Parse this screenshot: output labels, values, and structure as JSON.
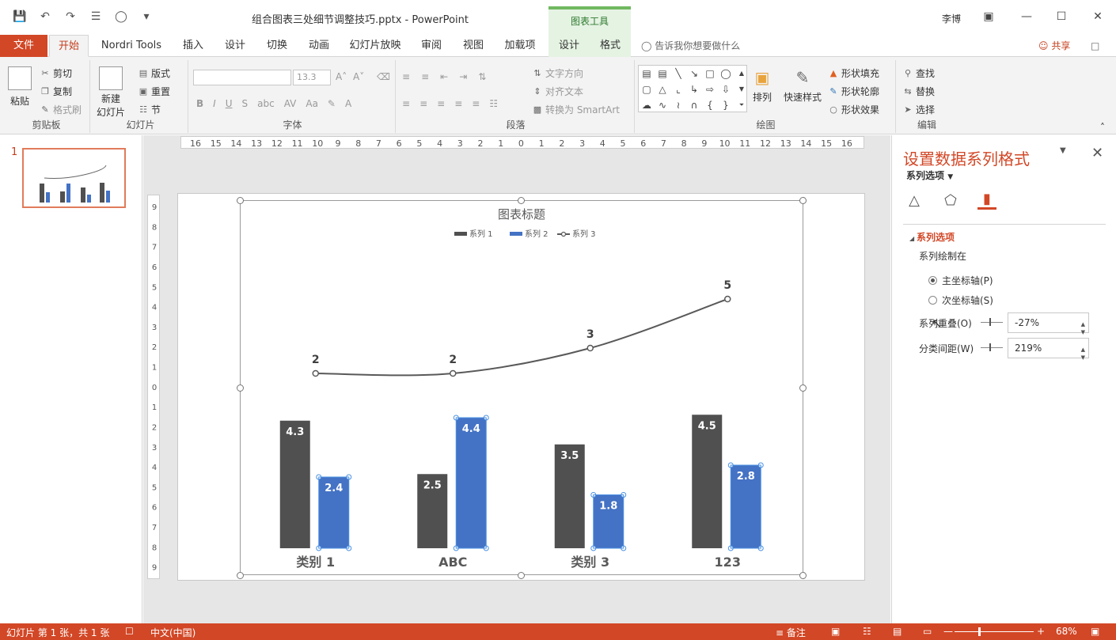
{
  "window": {
    "title": "组合图表三处细节调整技巧.pptx - PowerPoint",
    "context_tab_group": "图表工具",
    "user": "李博"
  },
  "tabs": {
    "file": "文件",
    "items": [
      "开始",
      "Nordri Tools",
      "插入",
      "设计",
      "切换",
      "动画",
      "幻灯片放映",
      "审阅",
      "视图",
      "加载项",
      "设计",
      "格式"
    ],
    "active_index": 0,
    "tell_me": "告诉我你想要做什么",
    "share": "共享"
  },
  "ribbon": {
    "clipboard": {
      "label": "剪贴板",
      "paste": "粘贴",
      "cut": "剪切",
      "copy": "复制",
      "format_painter": "格式刷"
    },
    "slides": {
      "label": "幻灯片",
      "new_slide_1": "新建",
      "new_slide_2": "幻灯片",
      "layout": "版式",
      "reset": "重置",
      "section": "节"
    },
    "font": {
      "label": "字体",
      "font_name": "",
      "font_size": "13.3"
    },
    "paragraph": {
      "label": "段落",
      "text_direction": "文字方向",
      "align_text": "对齐文本",
      "convert_smartart": "转换为 SmartArt"
    },
    "drawing": {
      "label": "绘图",
      "arrange": "排列",
      "quick_styles": "快速样式",
      "shape_fill": "形状填充",
      "shape_outline": "形状轮廓",
      "shape_effects": "形状效果"
    },
    "editing": {
      "label": "编辑",
      "find": "查找",
      "replace": "替换",
      "select": "选择"
    }
  },
  "thumbnails": {
    "number": "1"
  },
  "ruler": {
    "h_ticks": [
      "16",
      "15",
      "14",
      "13",
      "12",
      "11",
      "10",
      "9",
      "8",
      "7",
      "6",
      "5",
      "4",
      "3",
      "2",
      "1",
      "0",
      "1",
      "2",
      "3",
      "4",
      "5",
      "6",
      "7",
      "8",
      "9",
      "10",
      "11",
      "12",
      "13",
      "14",
      "15",
      "16"
    ],
    "v_ticks": [
      "9",
      "8",
      "7",
      "6",
      "5",
      "4",
      "3",
      "2",
      "1",
      "0",
      "1",
      "2",
      "3",
      "4",
      "5",
      "6",
      "7",
      "8",
      "9"
    ]
  },
  "chart_data": {
    "type": "bar",
    "title": "图表标题",
    "categories": [
      "类别 1",
      "ABC",
      "类别 3",
      "123"
    ],
    "series": [
      {
        "name": "系列 1",
        "type": "bar",
        "values": [
          4.3,
          2.5,
          3.5,
          4.5
        ],
        "color": "#505050"
      },
      {
        "name": "系列 2",
        "type": "bar",
        "values": [
          2.4,
          4.4,
          1.8,
          2.8
        ],
        "color": "#4472c4"
      },
      {
        "name": "系列 3",
        "type": "line",
        "values": [
          2,
          2,
          3,
          5
        ],
        "color": "#595959"
      }
    ],
    "legend_position": "top",
    "grid": false
  },
  "format_pane": {
    "title": "设置数据系列格式",
    "subtitle": "系列选项",
    "section": "系列选项",
    "plot_on": "系列绘制在",
    "primary_axis": "主坐标轴(P)",
    "secondary_axis": "次坐标轴(S)",
    "overlap_label": "系列重叠(O)",
    "overlap_value": "-27%",
    "gap_label": "分类间距(W)",
    "gap_value": "219%"
  },
  "status": {
    "slide_info": "幻灯片 第 1 张，共 1 张",
    "language": "中文(中国)",
    "notes": "备注",
    "zoom": "68%"
  }
}
